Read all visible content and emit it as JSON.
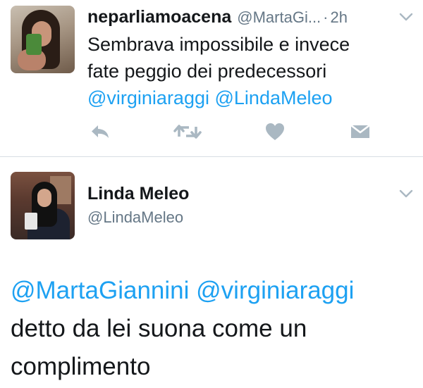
{
  "tweet_reply": {
    "display_name": "neparliamoacena",
    "handle": "@MartaGi...",
    "separator": "·",
    "time": "2h",
    "text_lines": [
      "Sembrava impossibile e invece",
      "fate peggio dei predecessori"
    ],
    "mentions": [
      "@virginiaraggi",
      "@LindaMeleo"
    ],
    "actions": {
      "reply_icon": "reply-icon",
      "retweet_icon": "retweet-icon",
      "like_icon": "heart-icon",
      "dm_icon": "envelope-icon"
    },
    "menu_icon": "chevron-down-icon"
  },
  "tweet_main": {
    "display_name": "Linda Meleo",
    "handle": "@LindaMeleo",
    "mentions": [
      "@MartaGiannini",
      "@virginiaraggi"
    ],
    "text_lines": [
      "detto da lei suona come un",
      "complimento"
    ],
    "menu_icon": "chevron-down-icon"
  },
  "colors": {
    "link": "#1da1f2",
    "secondary_text": "#657786",
    "icon_gray": "#aab8c2",
    "divider": "#d8dee3",
    "primary_text": "#14171a"
  }
}
